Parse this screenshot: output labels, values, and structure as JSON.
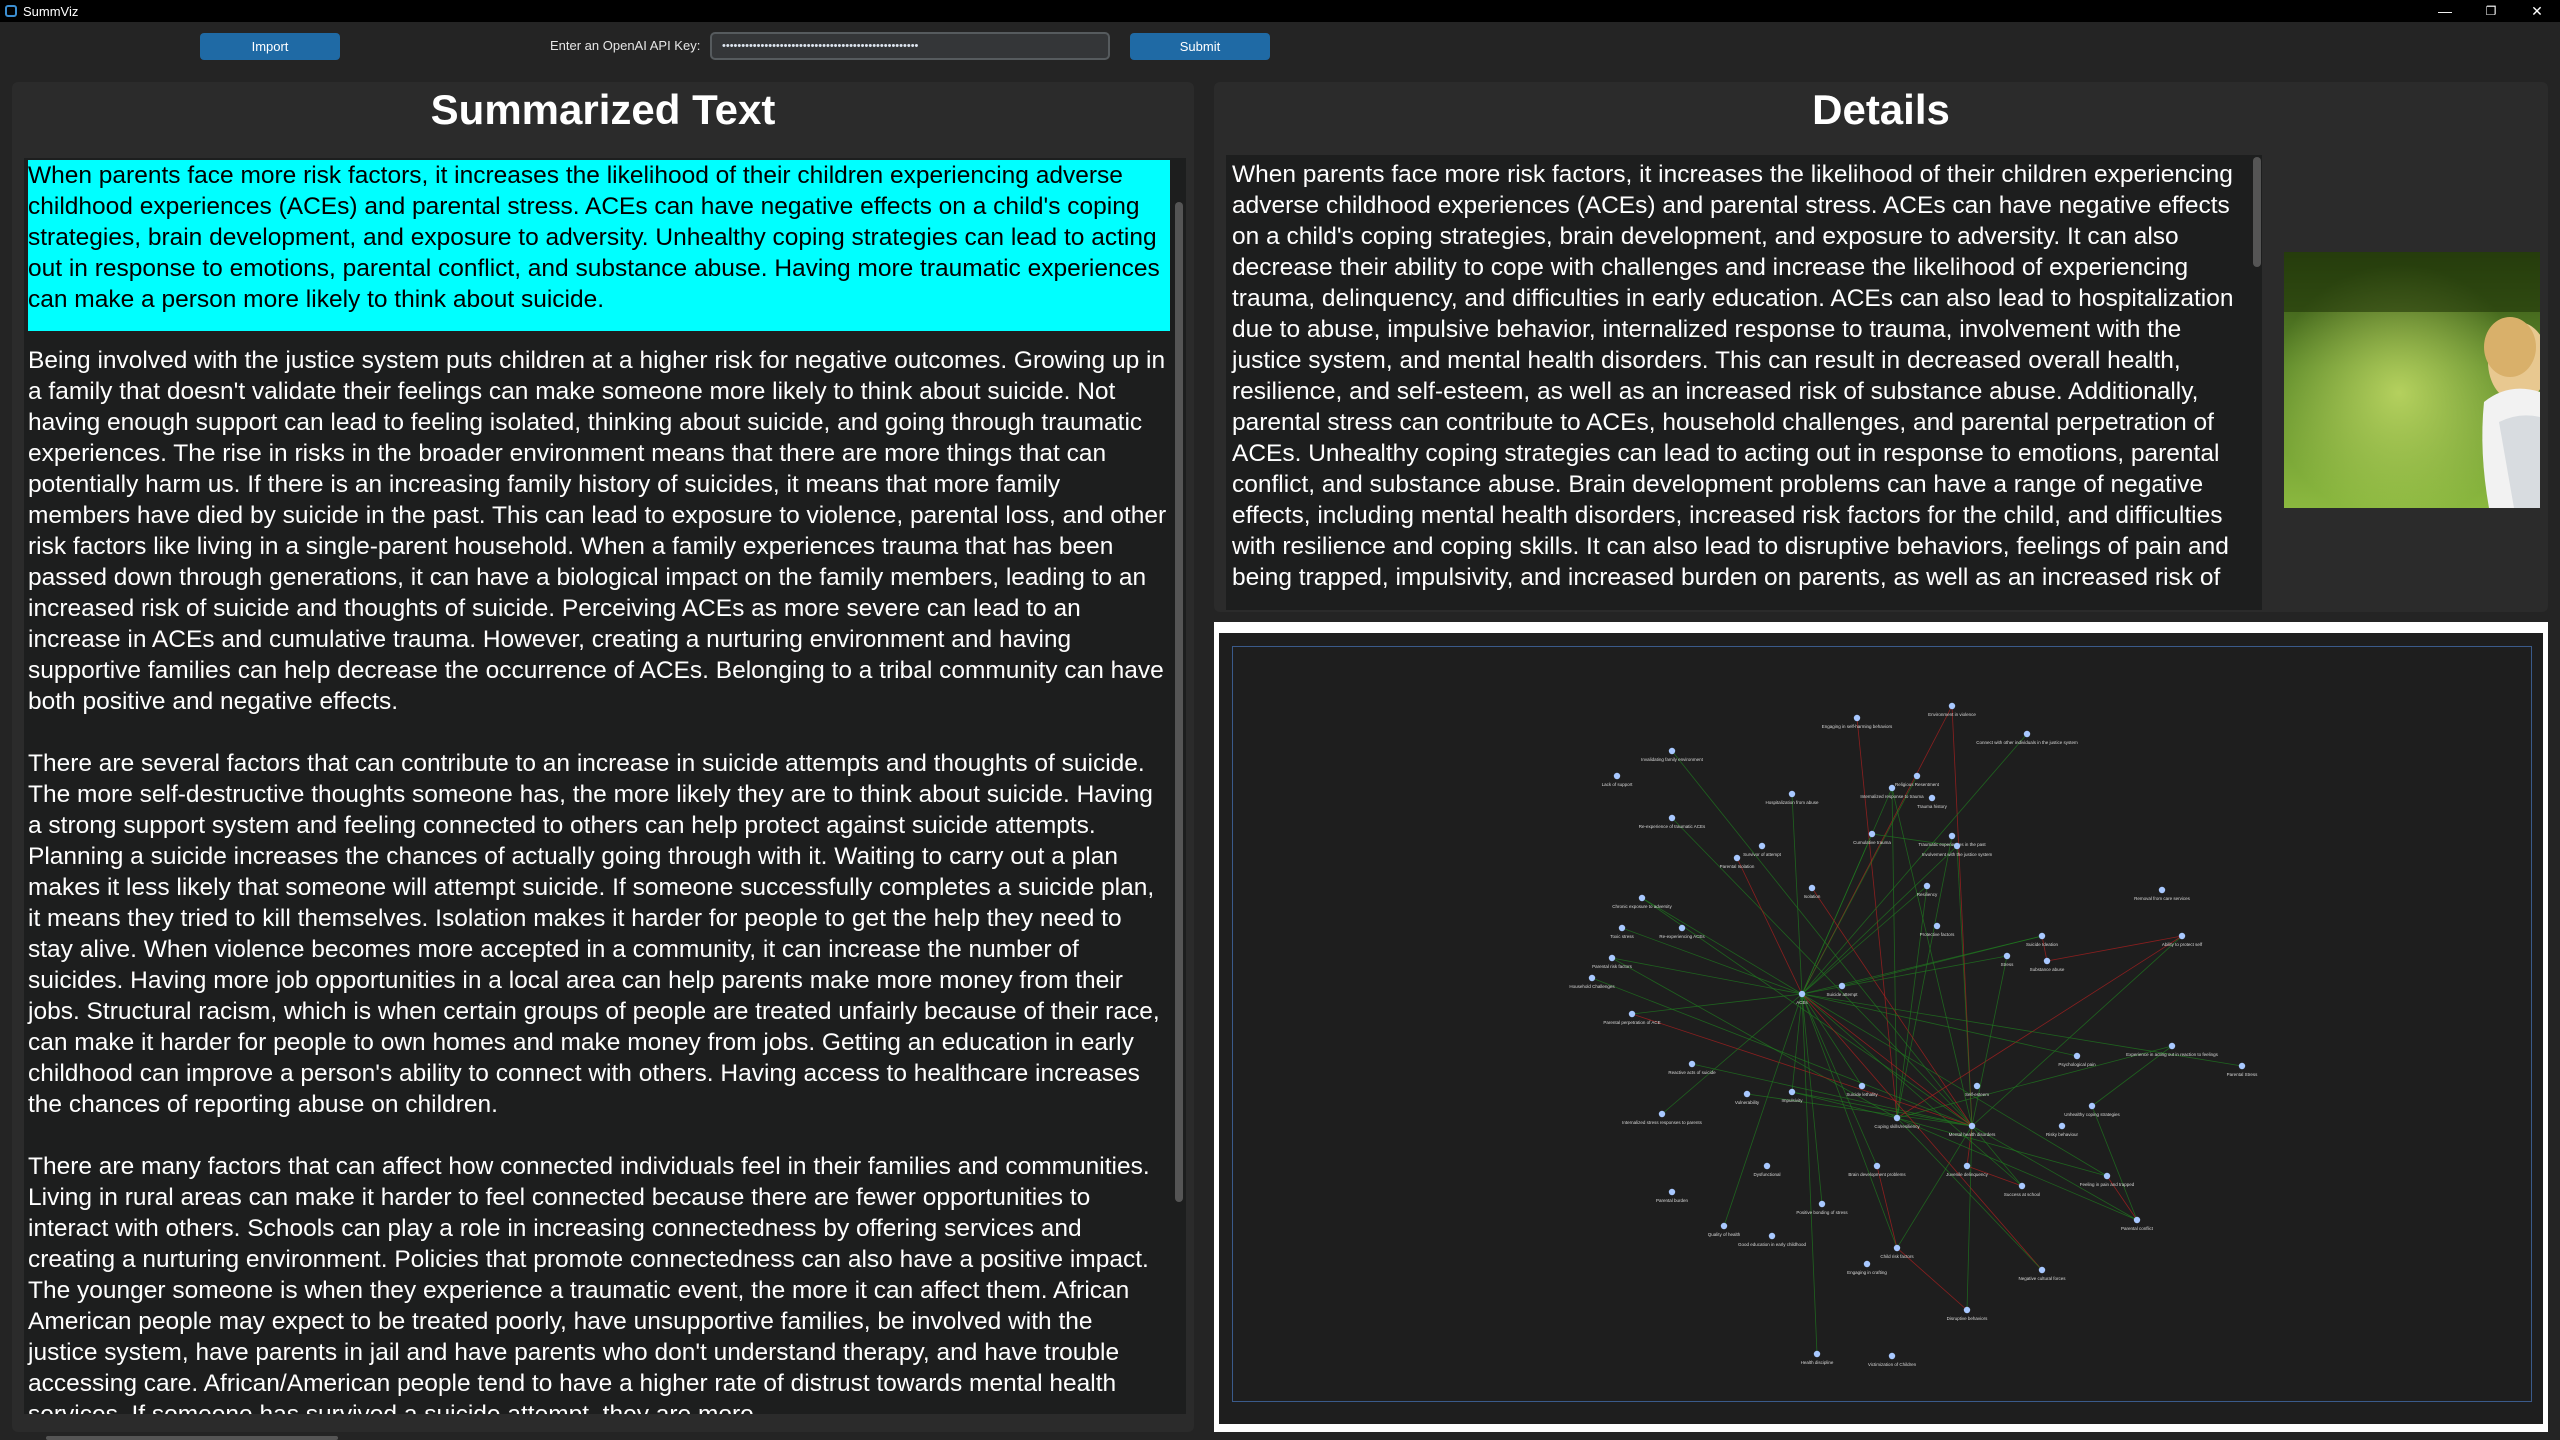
{
  "window": {
    "title": "SummViz",
    "controls": {
      "minimize": "—",
      "restore": "❐",
      "close": "✕"
    }
  },
  "toolbar": {
    "import_label": "Import",
    "api_label": "Enter an OpenAI API Key:",
    "api_value": "•••••••••••••••••••••••••••••••••••••••••••••••••••",
    "submit_label": "Submit"
  },
  "summary": {
    "title": "Summarized Text",
    "paragraphs": [
      "When parents face more risk factors, it increases the likelihood of their children experiencing adverse childhood experiences (ACEs) and parental stress. ACEs can have negative effects on a child's coping strategies, brain development, and exposure to adversity. Unhealthy coping strategies can lead to acting out in response to emotions, parental conflict, and substance abuse. Having more traumatic experiences can make a person more likely to think about suicide.",
      "Being involved with the justice system puts children at a higher risk for negative outcomes. Growing up in a family that doesn't validate their feelings can make someone more likely to think about suicide. Not having enough support can lead to feeling isolated, thinking about suicide, and going through traumatic experiences. The rise in risks in the broader environment means that there are more things that can potentially harm us. If there is an increasing family history of suicides, it means that more family members have died by suicide in the past. This can lead to exposure to violence, parental loss, and other risk factors like living in a single-parent household. When a family experiences trauma that has been passed down through generations, it can have a biological impact on the family members, leading to an increased risk of suicide and thoughts of suicide. Perceiving ACEs as more severe can lead to an increase in ACEs and cumulative trauma. However, creating a nurturing environment and having supportive families can help decrease the occurrence of ACEs. Belonging to a tribal community can have both positive and negative effects.",
      "There are several factors that can contribute to an increase in suicide attempts and thoughts of suicide. The more self-destructive thoughts someone has, the more likely they are to think about suicide. Having a strong support system and feeling connected to others can help protect against suicide attempts. Planning a suicide increases the chances of actually going through with it. Waiting to carry out a plan makes it less likely that someone will attempt suicide. If someone successfully completes a suicide plan, it means they tried to kill themselves. Isolation makes it harder for people to get the help they need to stay alive. When violence becomes more accepted in a community, it can increase the number of suicides. Having more job opportunities in a local area can help parents make more money from their jobs. Structural racism, which is when certain groups of people are treated unfairly because of their race, can make it harder for people to own homes and make money from jobs. Getting an education in early childhood can improve a person's ability to connect with others. Having access to healthcare increases the chances of reporting abuse on children.",
      "There are many factors that can affect how connected individuals feel in their families and communities. Living in rural areas can make it harder to feel connected because there are fewer opportunities to interact with others. Schools can play a role in increasing connectedness by offering services and creating a nurturing environment. Policies that promote connectedness can also have a positive impact. The younger someone is when they experience a traumatic event, the more it can affect them. African American people may expect to be treated poorly, have unsupportive families, be involved with the justice system, have parents in jail and have parents who don't understand therapy, and have trouble accessing care. African/American people tend to have a higher rate of distrust towards mental health services. If someone has survived a suicide attempt, they are more"
    ]
  },
  "details": {
    "title": "Details",
    "text": "When parents face more risk factors, it increases the likelihood of their children experiencing adverse childhood experiences (ACEs) and parental stress. ACEs can have negative effects on a child's coping strategies, brain development, and exposure to adversity. It can also decrease their ability to cope with challenges and increase the likelihood of experiencing trauma, delinquency, and difficulties in early education. ACEs can also lead to hospitalization due to abuse, impulsive behavior, internalized response to trauma, involvement with the justice system, and mental health disorders. This can result in decreased overall health, resilience, and self-esteem, as well as an increased risk of substance abuse. Additionally, parental stress can contribute to ACEs, household challenges, and parental perpetration of ACEs. Unhealthy coping strategies can lead to acting out in response to emotions, parental conflict, and substance abuse. Brain development problems can have a range of negative effects, including mental health disorders, increased risk factors for the child, and difficulties with resilience and coping skills. It can also lead to disruptive behaviors, feelings of pain and being trapped, impulsivity, and increased burden on parents, as well as an increased risk of"
  },
  "graph": {
    "highlight_color": "#00ffff",
    "edge_colors": {
      "positive": "#1f7a1f",
      "negative": "#b02020"
    },
    "node_color": "#a8c8ff",
    "nodes": [
      {
        "label": "Environment in violence"
      },
      {
        "label": "Engaging in self-harming behaviors"
      },
      {
        "label": "Connect with other individuals in the justice system"
      },
      {
        "label": "Invalidating family environment"
      },
      {
        "label": "Religious Resentment"
      },
      {
        "label": "Lack of support"
      },
      {
        "label": "Internalized response to trauma"
      },
      {
        "label": "Trauma history"
      },
      {
        "label": "Hospitalization from abuse"
      },
      {
        "label": "Re-experience of traumatic ACEs"
      },
      {
        "label": "Cumulative trauma"
      },
      {
        "label": "Traumatic experiences in the past"
      },
      {
        "label": "Involvement with the justice system"
      },
      {
        "label": "Survivor of attempt"
      },
      {
        "label": "Parental Isolation"
      },
      {
        "label": "Isolation"
      },
      {
        "label": "Resiliency"
      },
      {
        "label": "Removal from care services"
      },
      {
        "label": "Chronic exposure to adversity"
      },
      {
        "label": "Protective factors"
      },
      {
        "label": "Suicide Ideation"
      },
      {
        "label": "Ability to protect self"
      },
      {
        "label": "Toxic stress"
      },
      {
        "label": "Re-experiencing ACEs"
      },
      {
        "label": "Stress"
      },
      {
        "label": "Substance abuse"
      },
      {
        "label": "Parental risk factors"
      },
      {
        "label": "Household Challenges"
      },
      {
        "label": "ACEs"
      },
      {
        "label": "Suicide attempt"
      },
      {
        "label": "Parental perpetration of ACE"
      },
      {
        "label": "Experience in acting out in reaction to feelings"
      },
      {
        "label": "Parental Stress"
      },
      {
        "label": "Reactive acts of suicide"
      },
      {
        "label": "Psychological pain"
      },
      {
        "label": "Self-esteem"
      },
      {
        "label": "Impulsivity"
      },
      {
        "label": "Unhealthy coping strategies"
      },
      {
        "label": "Suicide lethality"
      },
      {
        "label": "Vulnerability"
      },
      {
        "label": "Internalized stress responses to parents"
      },
      {
        "label": "Coping skills/resiliency"
      },
      {
        "label": "Mental health disorders"
      },
      {
        "label": "Risky behaviour"
      },
      {
        "label": "Brain development problems"
      },
      {
        "label": "Juvenile delinquency"
      },
      {
        "label": "Feeling in pain and trapped"
      },
      {
        "label": "Dysfunctional"
      },
      {
        "label": "Success at school"
      },
      {
        "label": "Parental burden"
      },
      {
        "label": "Positive bonding of stress"
      },
      {
        "label": "Parental conflict"
      },
      {
        "label": "Quality of health"
      },
      {
        "label": "Good education in early childhood"
      },
      {
        "label": "Child risk factors"
      },
      {
        "label": "Engaging in crafting"
      },
      {
        "label": "Negative cultural forces"
      },
      {
        "label": "Disruptive behaviors"
      },
      {
        "label": "Health discipline"
      },
      {
        "label": "Victimization of Children"
      }
    ]
  }
}
